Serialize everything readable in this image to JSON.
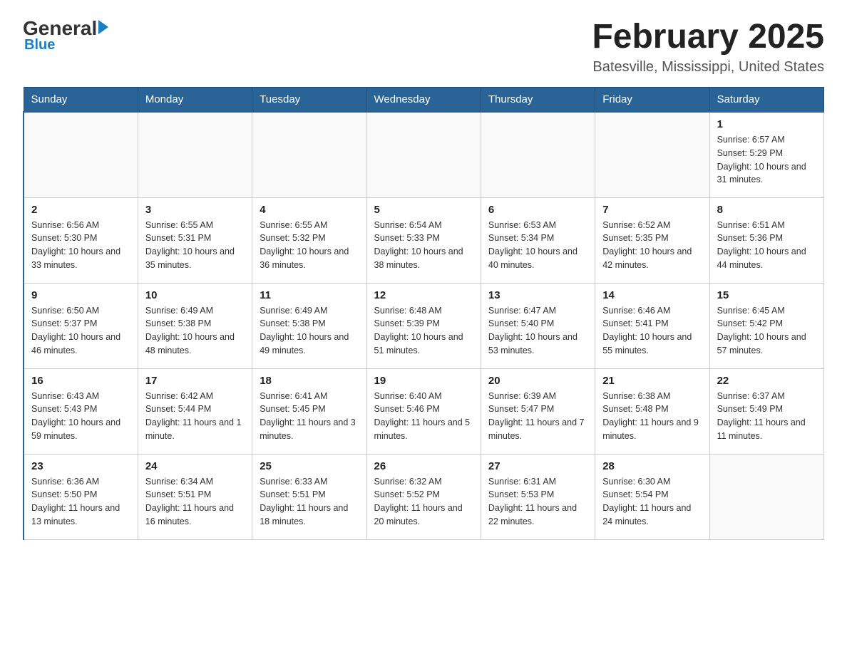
{
  "header": {
    "logo_general": "General",
    "logo_blue": "Blue",
    "title": "February 2025",
    "subtitle": "Batesville, Mississippi, United States"
  },
  "days_of_week": [
    "Sunday",
    "Monday",
    "Tuesday",
    "Wednesday",
    "Thursday",
    "Friday",
    "Saturday"
  ],
  "weeks": [
    {
      "days": [
        {
          "number": "",
          "info": ""
        },
        {
          "number": "",
          "info": ""
        },
        {
          "number": "",
          "info": ""
        },
        {
          "number": "",
          "info": ""
        },
        {
          "number": "",
          "info": ""
        },
        {
          "number": "",
          "info": ""
        },
        {
          "number": "1",
          "info": "Sunrise: 6:57 AM\nSunset: 5:29 PM\nDaylight: 10 hours and 31 minutes."
        }
      ]
    },
    {
      "days": [
        {
          "number": "2",
          "info": "Sunrise: 6:56 AM\nSunset: 5:30 PM\nDaylight: 10 hours and 33 minutes."
        },
        {
          "number": "3",
          "info": "Sunrise: 6:55 AM\nSunset: 5:31 PM\nDaylight: 10 hours and 35 minutes."
        },
        {
          "number": "4",
          "info": "Sunrise: 6:55 AM\nSunset: 5:32 PM\nDaylight: 10 hours and 36 minutes."
        },
        {
          "number": "5",
          "info": "Sunrise: 6:54 AM\nSunset: 5:33 PM\nDaylight: 10 hours and 38 minutes."
        },
        {
          "number": "6",
          "info": "Sunrise: 6:53 AM\nSunset: 5:34 PM\nDaylight: 10 hours and 40 minutes."
        },
        {
          "number": "7",
          "info": "Sunrise: 6:52 AM\nSunset: 5:35 PM\nDaylight: 10 hours and 42 minutes."
        },
        {
          "number": "8",
          "info": "Sunrise: 6:51 AM\nSunset: 5:36 PM\nDaylight: 10 hours and 44 minutes."
        }
      ]
    },
    {
      "days": [
        {
          "number": "9",
          "info": "Sunrise: 6:50 AM\nSunset: 5:37 PM\nDaylight: 10 hours and 46 minutes."
        },
        {
          "number": "10",
          "info": "Sunrise: 6:49 AM\nSunset: 5:38 PM\nDaylight: 10 hours and 48 minutes."
        },
        {
          "number": "11",
          "info": "Sunrise: 6:49 AM\nSunset: 5:38 PM\nDaylight: 10 hours and 49 minutes."
        },
        {
          "number": "12",
          "info": "Sunrise: 6:48 AM\nSunset: 5:39 PM\nDaylight: 10 hours and 51 minutes."
        },
        {
          "number": "13",
          "info": "Sunrise: 6:47 AM\nSunset: 5:40 PM\nDaylight: 10 hours and 53 minutes."
        },
        {
          "number": "14",
          "info": "Sunrise: 6:46 AM\nSunset: 5:41 PM\nDaylight: 10 hours and 55 minutes."
        },
        {
          "number": "15",
          "info": "Sunrise: 6:45 AM\nSunset: 5:42 PM\nDaylight: 10 hours and 57 minutes."
        }
      ]
    },
    {
      "days": [
        {
          "number": "16",
          "info": "Sunrise: 6:43 AM\nSunset: 5:43 PM\nDaylight: 10 hours and 59 minutes."
        },
        {
          "number": "17",
          "info": "Sunrise: 6:42 AM\nSunset: 5:44 PM\nDaylight: 11 hours and 1 minute."
        },
        {
          "number": "18",
          "info": "Sunrise: 6:41 AM\nSunset: 5:45 PM\nDaylight: 11 hours and 3 minutes."
        },
        {
          "number": "19",
          "info": "Sunrise: 6:40 AM\nSunset: 5:46 PM\nDaylight: 11 hours and 5 minutes."
        },
        {
          "number": "20",
          "info": "Sunrise: 6:39 AM\nSunset: 5:47 PM\nDaylight: 11 hours and 7 minutes."
        },
        {
          "number": "21",
          "info": "Sunrise: 6:38 AM\nSunset: 5:48 PM\nDaylight: 11 hours and 9 minutes."
        },
        {
          "number": "22",
          "info": "Sunrise: 6:37 AM\nSunset: 5:49 PM\nDaylight: 11 hours and 11 minutes."
        }
      ]
    },
    {
      "days": [
        {
          "number": "23",
          "info": "Sunrise: 6:36 AM\nSunset: 5:50 PM\nDaylight: 11 hours and 13 minutes."
        },
        {
          "number": "24",
          "info": "Sunrise: 6:34 AM\nSunset: 5:51 PM\nDaylight: 11 hours and 16 minutes."
        },
        {
          "number": "25",
          "info": "Sunrise: 6:33 AM\nSunset: 5:51 PM\nDaylight: 11 hours and 18 minutes."
        },
        {
          "number": "26",
          "info": "Sunrise: 6:32 AM\nSunset: 5:52 PM\nDaylight: 11 hours and 20 minutes."
        },
        {
          "number": "27",
          "info": "Sunrise: 6:31 AM\nSunset: 5:53 PM\nDaylight: 11 hours and 22 minutes."
        },
        {
          "number": "28",
          "info": "Sunrise: 6:30 AM\nSunset: 5:54 PM\nDaylight: 11 hours and 24 minutes."
        },
        {
          "number": "",
          "info": ""
        }
      ]
    }
  ]
}
